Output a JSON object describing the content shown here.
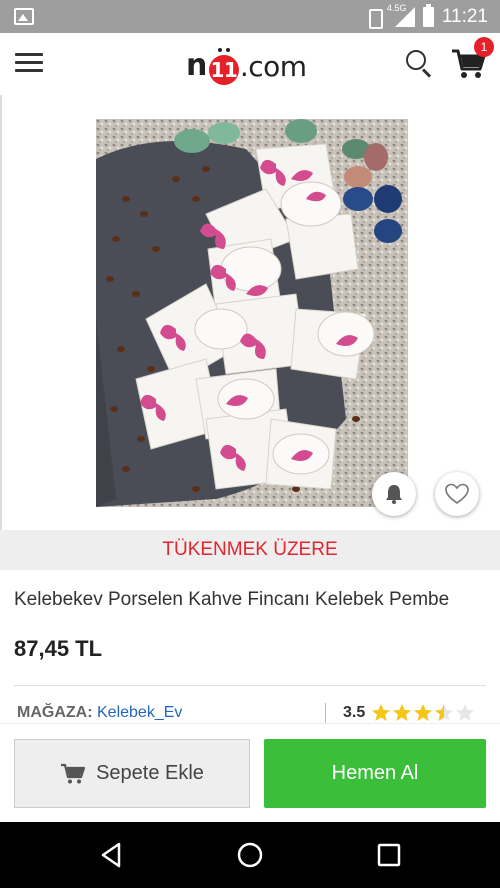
{
  "status_bar": {
    "time": "11:21",
    "network": "4.5G",
    "icons": [
      "image-icon",
      "vibrate-icon",
      "signal-icon",
      "battery-icon"
    ]
  },
  "header": {
    "logo_n": "n",
    "logo_bug": "11",
    "logo_com": ".com",
    "cart_count": "1",
    "icons": [
      "menu-icon",
      "search-icon",
      "cart-icon"
    ]
  },
  "product": {
    "stock_status": "TÜKENMEK ÜZERE",
    "title": "Kelebekev Porselen Kahve Fincanı Kelebek Pembe",
    "price": "87,45 TL",
    "store_label": "MAĞAZA:",
    "store_name": "Kelebek_Ev",
    "rating": "3.5",
    "rating_value": 3.5,
    "rating_max": 5
  },
  "actions": {
    "add_to_basket": "Sepete Ekle",
    "buy_now": "Hemen Al"
  },
  "colors": {
    "brand_red": "#e52028",
    "buy_green": "#3bbf3b",
    "store_link": "#2266bb",
    "star_gold": "#f5c518"
  }
}
